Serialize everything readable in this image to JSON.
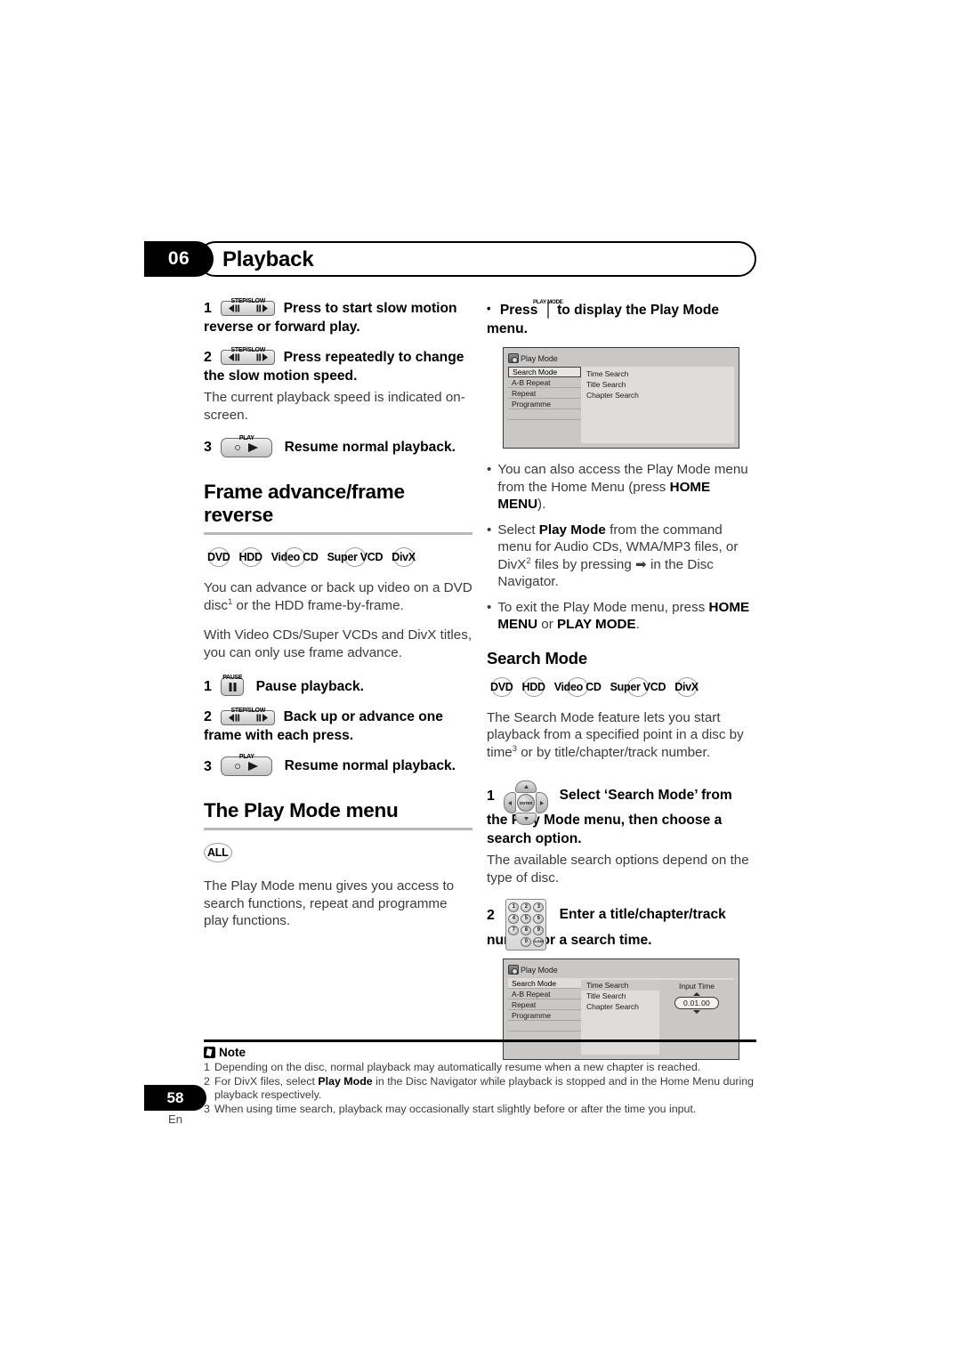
{
  "header": {
    "chapter_number": "06",
    "title": "Playback"
  },
  "left_column": {
    "steps_slow_motion": [
      {
        "num": "1",
        "key_label": "STEP/SLOW",
        "text": "Press to start slow motion reverse or forward play."
      },
      {
        "num": "2",
        "key_label": "STEP/SLOW",
        "text": "Press repeatedly to change the slow motion speed."
      },
      {
        "num": "3",
        "key_label": "PLAY",
        "text": "Resume normal playback."
      }
    ],
    "slow_motion_note": "The current playback speed is indicated on-screen.",
    "frame_section": {
      "heading": "Frame advance/frame reverse",
      "discs": [
        "DVD",
        "HDD",
        "Video CD",
        "Super VCD",
        "DivX"
      ],
      "paragraph_1_a": "You can advance or back up video on a DVD disc",
      "paragraph_1_sup": "1",
      "paragraph_1_b": " or the HDD frame-by-frame.",
      "paragraph_2": "With Video CDs/Super VCDs and DivX titles, you can only use frame advance.",
      "steps": [
        {
          "num": "1",
          "key_label": "PAUSE",
          "text": "Pause playback."
        },
        {
          "num": "2",
          "key_label": "STEP/SLOW",
          "text": "Back up or advance one frame with each press."
        },
        {
          "num": "3",
          "key_label": "PLAY",
          "text": "Resume normal playback."
        }
      ]
    },
    "play_mode_section": {
      "heading": "The Play Mode menu",
      "discs": [
        "ALL"
      ],
      "paragraph": "The Play Mode menu gives you access to search functions, repeat and programme play functions."
    }
  },
  "right_column": {
    "press_bullet": {
      "bullet": "•",
      "press_word": "Press",
      "key_label": "PLAY MODE",
      "text_after": "to display the Play Mode menu."
    },
    "osd_top": {
      "title": "Play Mode",
      "menu_items": [
        "Search Mode",
        "A-B Repeat",
        "Repeat",
        "Programme"
      ],
      "selected_menu_item": "Search Mode",
      "sub_items": [
        "Time Search",
        "Title Search",
        "Chapter Search"
      ]
    },
    "bullets": [
      {
        "parts": [
          {
            "t": "You can also access the Play Mode menu from the Home Menu (press ",
            "b": false
          },
          {
            "t": "HOME MENU",
            "b": true
          },
          {
            "t": ").",
            "b": false
          }
        ]
      },
      {
        "parts": [
          {
            "t": "Select ",
            "b": false
          },
          {
            "t": "Play Mode",
            "b": true
          },
          {
            "t": " from the command menu for Audio CDs, WMA/MP3 files, or DivX",
            "b": false
          },
          {
            "t": "2",
            "sup": true
          },
          {
            "t": " files by pressing ➡ in the Disc Navigator.",
            "b": false
          }
        ]
      },
      {
        "parts": [
          {
            "t": "To exit the Play Mode menu, press ",
            "b": false
          },
          {
            "t": "HOME MENU",
            "b": true
          },
          {
            "t": " or ",
            "b": false
          },
          {
            "t": "PLAY MODE",
            "b": true
          },
          {
            "t": ".",
            "b": false
          }
        ]
      }
    ],
    "search_section": {
      "heading": "Search Mode",
      "discs": [
        "DVD",
        "HDD",
        "Video CD",
        "Super VCD",
        "DivX"
      ],
      "intro_a": "The Search Mode feature lets you start playback from a specified point in a disc by time",
      "intro_sup": "3",
      "intro_b": " or by title/chapter/track number.",
      "steps": [
        {
          "num": "1",
          "key": "dpad",
          "text": "Select ‘Search Mode’ from the Play Mode menu, then choose a search option."
        },
        {
          "num": "2",
          "key": "numpad",
          "text": "Enter a title/chapter/track number or a search time."
        }
      ],
      "step1_note": "The available search options depend on the type of disc.",
      "numpad_keys": [
        "1",
        "2",
        "3",
        "4",
        "5",
        "6",
        "7",
        "8",
        "9",
        "0",
        "CLEAR"
      ],
      "dpad_enter_label": "ENTER"
    },
    "osd_bottom": {
      "title": "Play Mode",
      "menu_items": [
        "Search Mode",
        "A-B Repeat",
        "Repeat",
        "Programme"
      ],
      "selected_menu_item": "Search Mode",
      "sub_items": [
        "Time Search",
        "Title Search",
        "Chapter Search"
      ],
      "selected_sub_item": "Time Search",
      "input_label": "Input Time",
      "input_value": "0.01.00"
    }
  },
  "footer": {
    "note_label": "Note",
    "notes": [
      {
        "num": "1",
        "parts": [
          {
            "t": "Depending on the disc, normal playback may automatically resume when a new chapter is reached.",
            "b": false
          }
        ]
      },
      {
        "num": "2",
        "parts": [
          {
            "t": "For DivX files, select ",
            "b": false
          },
          {
            "t": "Play Mode",
            "b": true
          },
          {
            "t": " in the Disc Navigator while playback is stopped and in the Home Menu during playback respectively.",
            "b": false
          }
        ]
      },
      {
        "num": "3",
        "parts": [
          {
            "t": "When using time search, playback may occasionally start slightly before or after the time you input.",
            "b": false
          }
        ]
      }
    ],
    "page_number": "58",
    "language": "En"
  }
}
